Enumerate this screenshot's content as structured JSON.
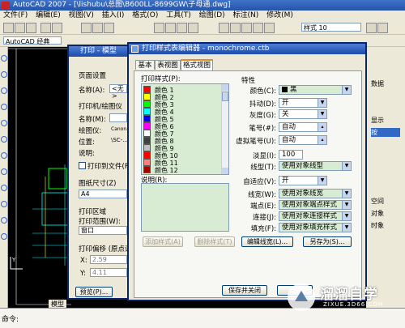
{
  "app": {
    "title": "AutoCAD 2007 - [\\lishubu\\总图\\B600LL-8699GW\\子母通.dwg]",
    "menu": [
      "文件(F)",
      "编辑(E)",
      "视图(V)",
      "插入(I)",
      "格式(O)",
      "工具(T)",
      "绘图(D)",
      "标注(N)",
      "修改(M)"
    ],
    "workspace": "AutoCAD 经典",
    "style_combo": "样式 10",
    "right_panel": [
      "数据",
      "显示",
      "按",
      "空间",
      "对象",
      "时象"
    ],
    "model_tab": "模型",
    "command_prompt": "命令:"
  },
  "plot_dialog": {
    "title": "打印 - 模型",
    "page_setup_label": "页面设置",
    "name_label": "名称(A):",
    "name_value": "<无>",
    "printer_label": "打印机/绘图仪",
    "printer_name_label": "名称(M):",
    "plotter_label": "绘图仪:",
    "plotter_value": "Canon...",
    "location_label": "位置:",
    "location_value": "\\SC-...",
    "desc_label": "说明:",
    "print_to_file": "打印到文件(F)",
    "paper_size_label": "图纸尺寸(Z)",
    "paper_size_value": "A4",
    "plot_area_label": "打印区域",
    "plot_range_label": "打印范围(W):",
    "plot_range_value": "窗口",
    "offset_label": "打印偏移 (原点设",
    "x_label": "X:",
    "x_value": "2.59",
    "y_label": "Y:",
    "y_value": "4.11",
    "preview_button": "预览(P)..."
  },
  "editor": {
    "title": "打印样式表编辑器 - monochrome.ctb",
    "tabs": [
      "基本",
      "表视图",
      "格式视图"
    ],
    "active_tab": 2,
    "styles_label": "打印样式(P):",
    "styles": [
      {
        "name": "颜色 1",
        "color": "#ff0000"
      },
      {
        "name": "颜色 2",
        "color": "#ffff00"
      },
      {
        "name": "颜色 3",
        "color": "#00ff00"
      },
      {
        "name": "颜色 4",
        "color": "#00ffff"
      },
      {
        "name": "颜色 5",
        "color": "#0000ff"
      },
      {
        "name": "颜色 6",
        "color": "#ff00ff"
      },
      {
        "name": "颜色 7",
        "color": "#ffffff"
      },
      {
        "name": "颜色 8",
        "color": "#414141"
      },
      {
        "name": "颜色 9",
        "color": "#c0c0c0"
      },
      {
        "name": "颜色 10",
        "color": "#ff0000"
      },
      {
        "name": "颜色 11",
        "color": "#ff7f7f"
      },
      {
        "name": "颜色 12",
        "color": "#a50000"
      }
    ],
    "desc_label": "说明(R):",
    "add_style_button": "添加样式(A)",
    "delete_style_button": "删除样式(T)",
    "properties_label": "特性",
    "color_label": "颜色(C):",
    "color_value": "黑",
    "dither_label": "抖动(D):",
    "dither_value": "开",
    "grayscale_label": "灰度(G):",
    "grayscale_value": "关",
    "pen_label": "笔号(#):",
    "pen_value": "自动",
    "virtual_pen_label": "虚拟笔号(U):",
    "virtual_pen_value": "自动",
    "screening_label": "淡显(I):",
    "screening_value": "100",
    "linetype_label": "线型(T):",
    "linetype_value": "使用对象线型",
    "adaptive_label": "自适应(V):",
    "adaptive_value": "开",
    "lineweight_label": "线宽(W):",
    "lineweight_value": "使用对象线宽",
    "endstyle_label": "端点(E):",
    "endstyle_value": "使用对象端点样式",
    "joinstyle_label": "连接(J):",
    "joinstyle_value": "使用对象连接样式",
    "fillstyle_label": "填充(F):",
    "fillstyle_value": "使用对象填充样式",
    "edit_lineweights_button": "编辑线宽(L)...",
    "save_as_button": "另存为(S)...",
    "save_close_button": "保存并关闭"
  },
  "watermark": {
    "text": "溜溜自学",
    "sub": "ZIXUE.3D66.COM"
  }
}
